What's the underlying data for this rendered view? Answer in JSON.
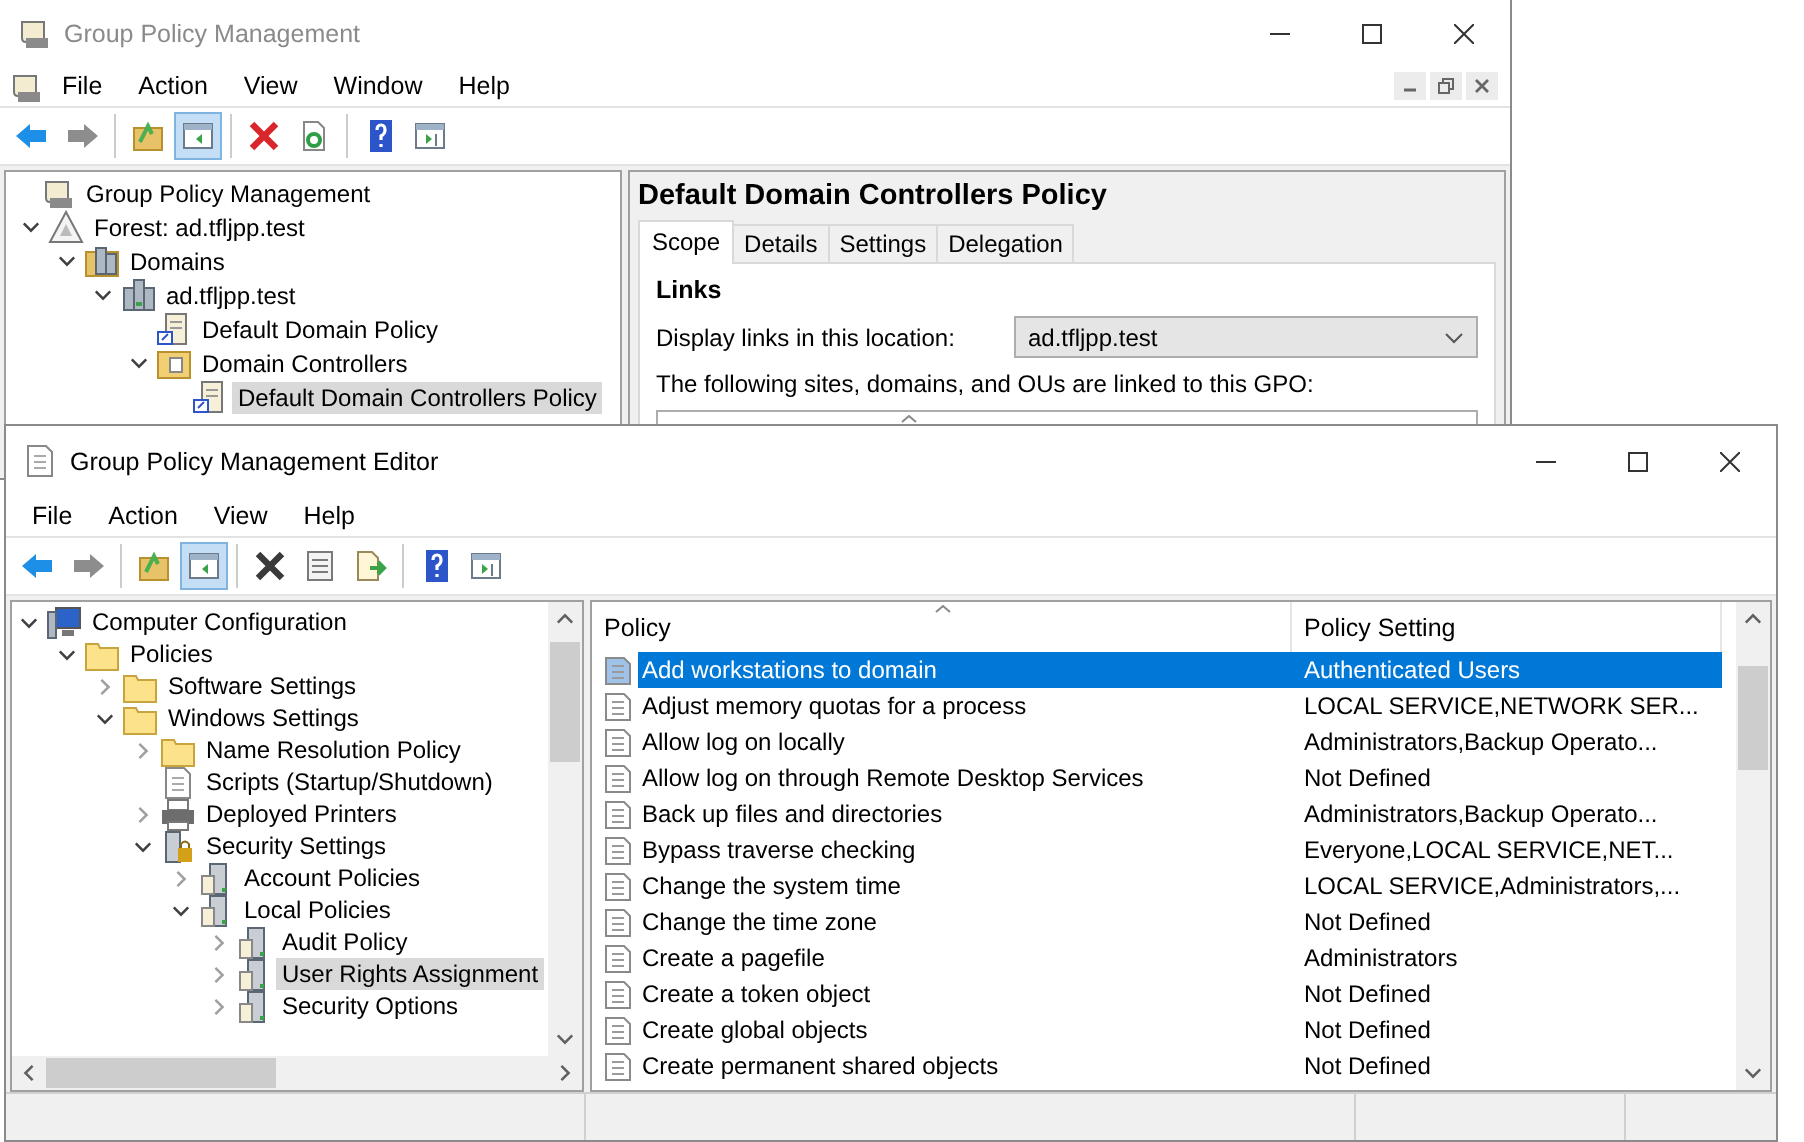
{
  "back_window": {
    "title": "Group Policy Management",
    "menu": [
      "File",
      "Action",
      "View",
      "Window",
      "Help"
    ],
    "toolbar": [
      [
        {
          "kind": "back",
          "pressed": false
        },
        {
          "kind": "forward",
          "pressed": false
        }
      ],
      [
        {
          "kind": "up",
          "pressed": false
        },
        {
          "kind": "tree",
          "pressed": true
        }
      ],
      [
        {
          "kind": "delete",
          "pressed": false
        },
        {
          "kind": "refresh",
          "pressed": false
        }
      ],
      [
        {
          "kind": "help",
          "pressed": false
        },
        {
          "kind": "panel",
          "pressed": false
        }
      ]
    ],
    "tree": [
      {
        "label": "Group Policy Management",
        "kind": "console",
        "selected": false,
        "children": [
          {
            "label": "Forest: ad.tfljpp.test",
            "kind": "forest",
            "expanded": true,
            "selected": false,
            "children": [
              {
                "label": "Domains",
                "kind": "domains",
                "expanded": true,
                "selected": false,
                "children": [
                  {
                    "label": "ad.tfljpp.test",
                    "kind": "domain",
                    "expanded": true,
                    "selected": false,
                    "children": [
                      {
                        "label": "Default Domain Policy",
                        "kind": "gpo",
                        "selected": false
                      },
                      {
                        "label": "Domain Controllers",
                        "kind": "ou",
                        "expanded": true,
                        "selected": false,
                        "children": [
                          {
                            "label": "Default Domain Controllers Policy",
                            "kind": "gpo",
                            "selected": true
                          }
                        ]
                      }
                    ]
                  }
                ]
              }
            ]
          }
        ]
      }
    ],
    "details": {
      "heading": "Default Domain Controllers Policy",
      "tabs": [
        {
          "label": "Scope",
          "selected": true
        },
        {
          "label": "Details",
          "selected": false
        },
        {
          "label": "Settings",
          "selected": false
        },
        {
          "label": "Delegation",
          "selected": false
        }
      ],
      "section": "Links",
      "location_label": "Display links in this location:",
      "location_value": "ad.tfljpp.test",
      "links_note": "The following sites, domains, and OUs are linked to this GPO:"
    }
  },
  "front_window": {
    "title": "Group Policy Management Editor",
    "menu": [
      "File",
      "Action",
      "View",
      "Help"
    ],
    "toolbar": [
      [
        {
          "kind": "back",
          "pressed": false
        },
        {
          "kind": "forward",
          "pressed": false
        }
      ],
      [
        {
          "kind": "up",
          "pressed": false
        },
        {
          "kind": "tree",
          "pressed": true
        }
      ],
      [
        {
          "kind": "delete-dark",
          "pressed": false
        },
        {
          "kind": "properties",
          "pressed": false
        },
        {
          "kind": "export",
          "pressed": false
        }
      ],
      [
        {
          "kind": "help",
          "pressed": false
        },
        {
          "kind": "panel",
          "pressed": false
        }
      ]
    ],
    "tree": [
      {
        "label": "Computer Configuration",
        "kind": "computer",
        "expanded": true,
        "selected": false,
        "children": [
          {
            "label": "Policies",
            "kind": "folder",
            "expanded": true,
            "selected": false,
            "children": [
              {
                "label": "Software Settings",
                "kind": "folder",
                "expanded": false,
                "selected": false
              },
              {
                "label": "Windows Settings",
                "kind": "folder",
                "expanded": true,
                "selected": false,
                "children": [
                  {
                    "label": "Name Resolution Policy",
                    "kind": "folder",
                    "expanded": false,
                    "selected": false
                  },
                  {
                    "label": "Scripts (Startup/Shutdown)",
                    "kind": "script",
                    "selected": false
                  },
                  {
                    "label": "Deployed Printers",
                    "kind": "printer",
                    "expanded": false,
                    "selected": false
                  },
                  {
                    "label": "Security Settings",
                    "kind": "security",
                    "expanded": true,
                    "selected": false,
                    "children": [
                      {
                        "label": "Account Policies",
                        "kind": "policy",
                        "expanded": false,
                        "selected": false
                      },
                      {
                        "label": "Local Policies",
                        "kind": "policy",
                        "expanded": true,
                        "selected": false,
                        "children": [
                          {
                            "label": "Audit Policy",
                            "kind": "policy",
                            "expanded": false,
                            "selected": false
                          },
                          {
                            "label": "User Rights Assignment",
                            "kind": "policy",
                            "expanded": false,
                            "selected": true
                          },
                          {
                            "label": "Security Options",
                            "kind": "policy",
                            "expanded": false,
                            "selected": false
                          }
                        ]
                      }
                    ]
                  }
                ]
              }
            ]
          }
        ]
      }
    ],
    "columns": [
      "Policy",
      "Policy Setting"
    ],
    "rows": [
      {
        "policy": "Add workstations to domain",
        "setting": "Authenticated Users",
        "selected": true
      },
      {
        "policy": "Adjust memory quotas for a process",
        "setting": "LOCAL SERVICE,NETWORK SER...",
        "selected": false
      },
      {
        "policy": "Allow log on locally",
        "setting": "Administrators,Backup Operato...",
        "selected": false
      },
      {
        "policy": "Allow log on through Remote Desktop Services",
        "setting": "Not Defined",
        "selected": false
      },
      {
        "policy": "Back up files and directories",
        "setting": "Administrators,Backup Operato...",
        "selected": false
      },
      {
        "policy": "Bypass traverse checking",
        "setting": "Everyone,LOCAL SERVICE,NET...",
        "selected": false
      },
      {
        "policy": "Change the system time",
        "setting": "LOCAL SERVICE,Administrators,...",
        "selected": false
      },
      {
        "policy": "Change the time zone",
        "setting": "Not Defined",
        "selected": false
      },
      {
        "policy": "Create a pagefile",
        "setting": "Administrators",
        "selected": false
      },
      {
        "policy": "Create a token object",
        "setting": "Not Defined",
        "selected": false
      },
      {
        "policy": "Create global objects",
        "setting": "Not Defined",
        "selected": false
      },
      {
        "policy": "Create permanent shared objects",
        "setting": "Not Defined",
        "selected": false
      }
    ]
  }
}
